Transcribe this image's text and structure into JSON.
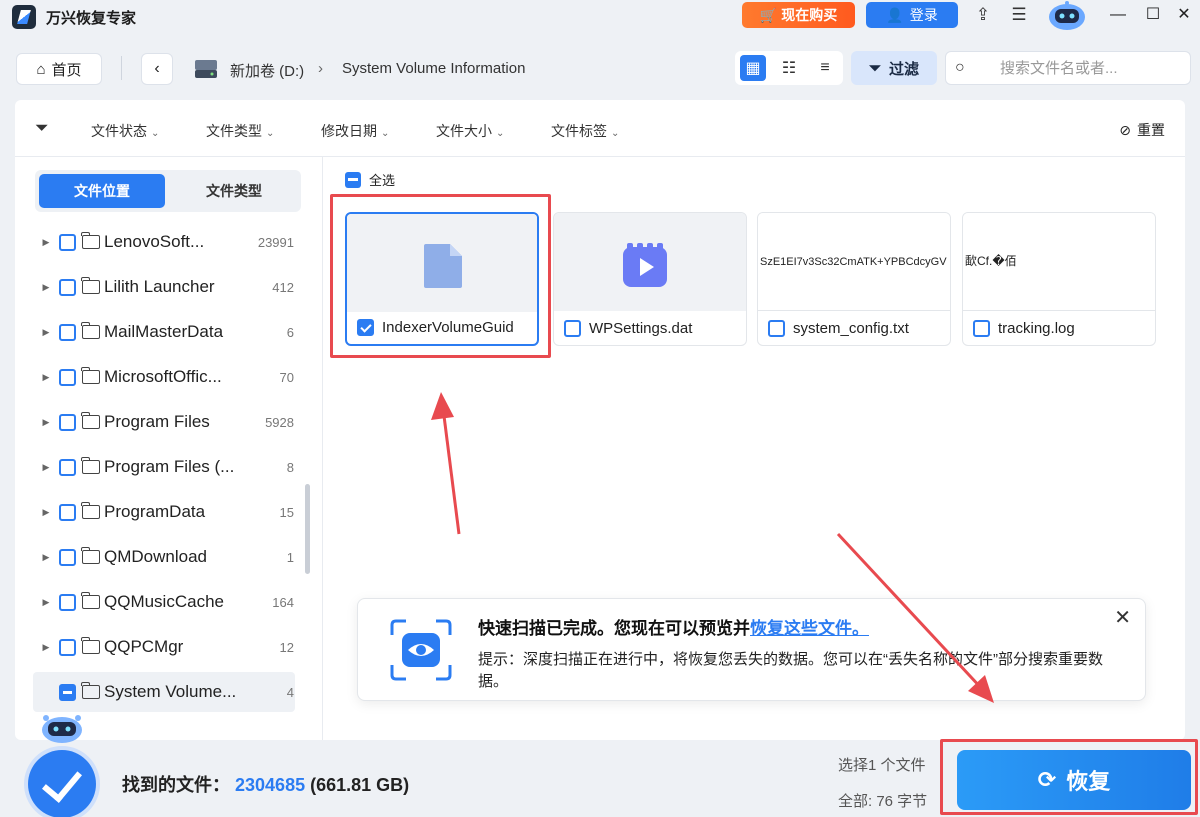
{
  "titlebar": {
    "app_title": "万兴恢复专家",
    "buy_label": "现在购买",
    "login_label": "登录"
  },
  "nav": {
    "home_label": "首页",
    "crumbs": [
      "新加卷 (D:)",
      "System Volume Information"
    ],
    "filter_label": "过滤",
    "search_placeholder": "搜索文件名或者..."
  },
  "filters": {
    "items": [
      "文件状态",
      "文件类型",
      "修改日期",
      "文件大小",
      "文件标签"
    ],
    "reset_label": "重置"
  },
  "sidebar": {
    "tabs": [
      "文件位置",
      "文件类型"
    ],
    "items": [
      {
        "name": "LenovoSoft...",
        "count": "23991"
      },
      {
        "name": "Lilith Launcher",
        "count": "412"
      },
      {
        "name": "MailMasterData",
        "count": "6"
      },
      {
        "name": "MicrosoftOffic...",
        "count": "70"
      },
      {
        "name": "Program Files",
        "count": "5928"
      },
      {
        "name": "Program Files (...",
        "count": "8"
      },
      {
        "name": "ProgramData",
        "count": "15"
      },
      {
        "name": "QMDownload",
        "count": "1"
      },
      {
        "name": "QQMusicCache",
        "count": "164"
      },
      {
        "name": "QQPCMgr",
        "count": "12"
      },
      {
        "name": "System Volume...",
        "count": "4"
      }
    ]
  },
  "content": {
    "select_all_label": "全选",
    "files": [
      {
        "name": "IndexerVolumeGuid",
        "checked": true,
        "preview": ""
      },
      {
        "name": "WPSettings.dat",
        "checked": false,
        "preview": ""
      },
      {
        "name": "system_config.txt",
        "checked": false,
        "preview": "SzE1EI7v3Sc32CmATK+YPBCdcyGV"
      },
      {
        "name": "tracking.log",
        "checked": false,
        "preview": "歃Cf.�佰"
      }
    ]
  },
  "notice": {
    "title_prefix": "快速扫描已完成。您现在可以预览并",
    "title_link": "恢复这些文件。",
    "body": "提示：深度扫描正在进行中，将恢复您丢失的数据。您可以在“丢失名称的文件”部分搜索重要数据。"
  },
  "footer": {
    "found_label": "找到的文件：",
    "found_count": "2304685",
    "found_size": "(661.81 GB)",
    "selected_info": "选择1 个文件",
    "total_info": "全部: 76 字节",
    "recover_label": "恢复"
  },
  "colors": {
    "accent": "#2b7cf2",
    "buy": "#ff6a26",
    "annotation": "#e84a4f"
  }
}
